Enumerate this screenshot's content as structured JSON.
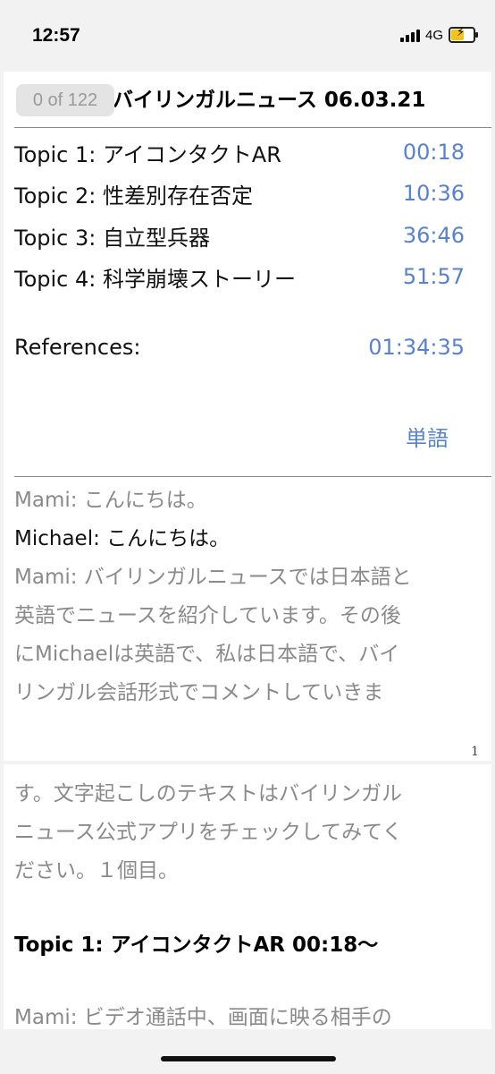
{
  "status_bar": {
    "time": "12:57",
    "network": "4G"
  },
  "document": {
    "page_counter": "0 of 122",
    "title": "バイリンガルニュース 06.03.21"
  },
  "topics": [
    {
      "label": "Topic 1: アイコンタクトAR",
      "time": "00:18"
    },
    {
      "label": "Topic 2: 性差別存在否定",
      "time": "10:36"
    },
    {
      "label": "Topic 3: 自立型兵器",
      "time": "36:46"
    },
    {
      "label": "Topic 4: 科学崩壊ストーリー",
      "time": "51:57"
    }
  ],
  "references": {
    "label": "References:",
    "time": "01:34:35"
  },
  "vocab_link": "単語",
  "transcript_page1": [
    "Mami: こんにちは。",
    "Michael: こんにちは。",
    "Mami: バイリンガルニュースでは日本語と",
    "英語でニュースを紹介しています。その後",
    "にMichaelは英語で、私は日本語で、バイ",
    "リンガル会話形式でコメントしていきま"
  ],
  "page_number": "1",
  "transcript_page2": [
    "す。文字起こしのテキストはバイリンガル",
    "ニュース公式アプリをチェックしてみてく",
    "ださい。１個目。"
  ],
  "section_heading": "Topic 1: アイコンタクトAR 00:18〜",
  "transcript_page2_next": "Mami: ビデオ通話中、画面に映る相手の"
}
